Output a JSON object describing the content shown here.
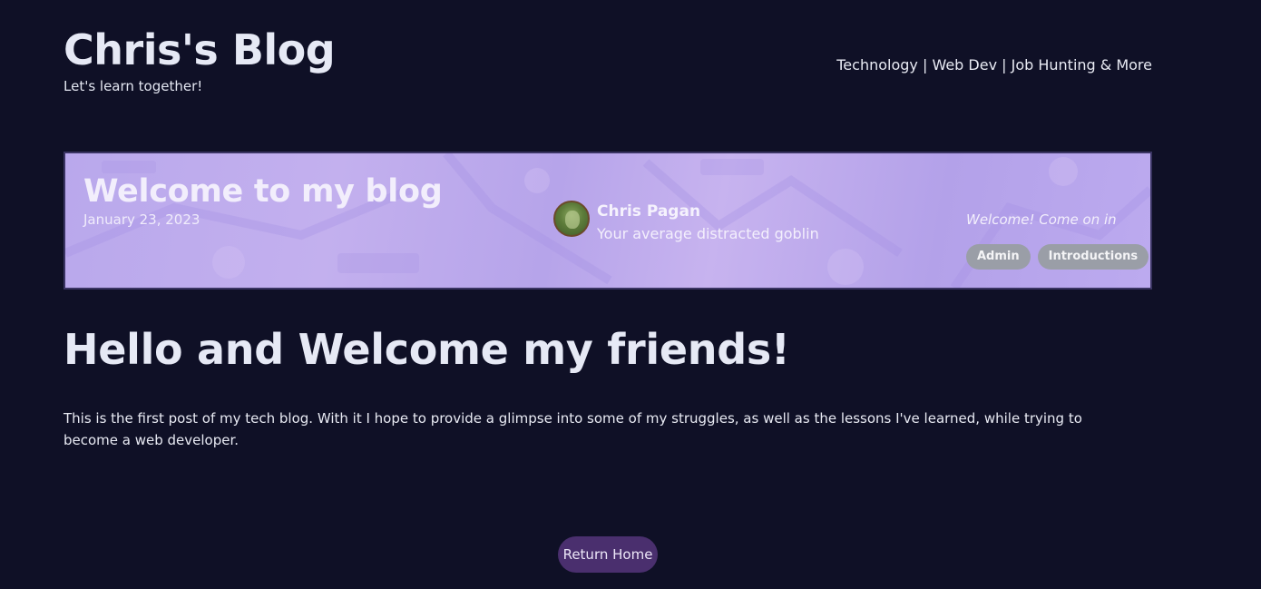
{
  "header": {
    "title": "Chris's Blog",
    "tagline": "Let's learn together!",
    "nav": {
      "technology": "Technology",
      "sep1": " | ",
      "web_dev": "Web Dev",
      "sep2": " | ",
      "job_hunting": "Job Hunting & More"
    }
  },
  "hero": {
    "title": "Welcome to my blog",
    "date": "January 23, 2023",
    "author": {
      "name": "Chris Pagan",
      "bio": "Your average distracted goblin",
      "avatar_icon": "author-avatar"
    },
    "excerpt": "Welcome! Come on in",
    "tags": [
      "Admin",
      "Introductions"
    ]
  },
  "post": {
    "heading": "Hello and Welcome my friends!",
    "body": "This is the first post of my tech blog. With it I hope to provide a glimpse into some of my struggles, as well as the lessons I've learned, while trying to become a web developer."
  },
  "footer": {
    "return_label": "Return Home"
  },
  "colors": {
    "background": "#0f1026",
    "hero_accent": "#b9a8ec",
    "button": "#4a2f6e",
    "tag": "#9a9ea7"
  }
}
